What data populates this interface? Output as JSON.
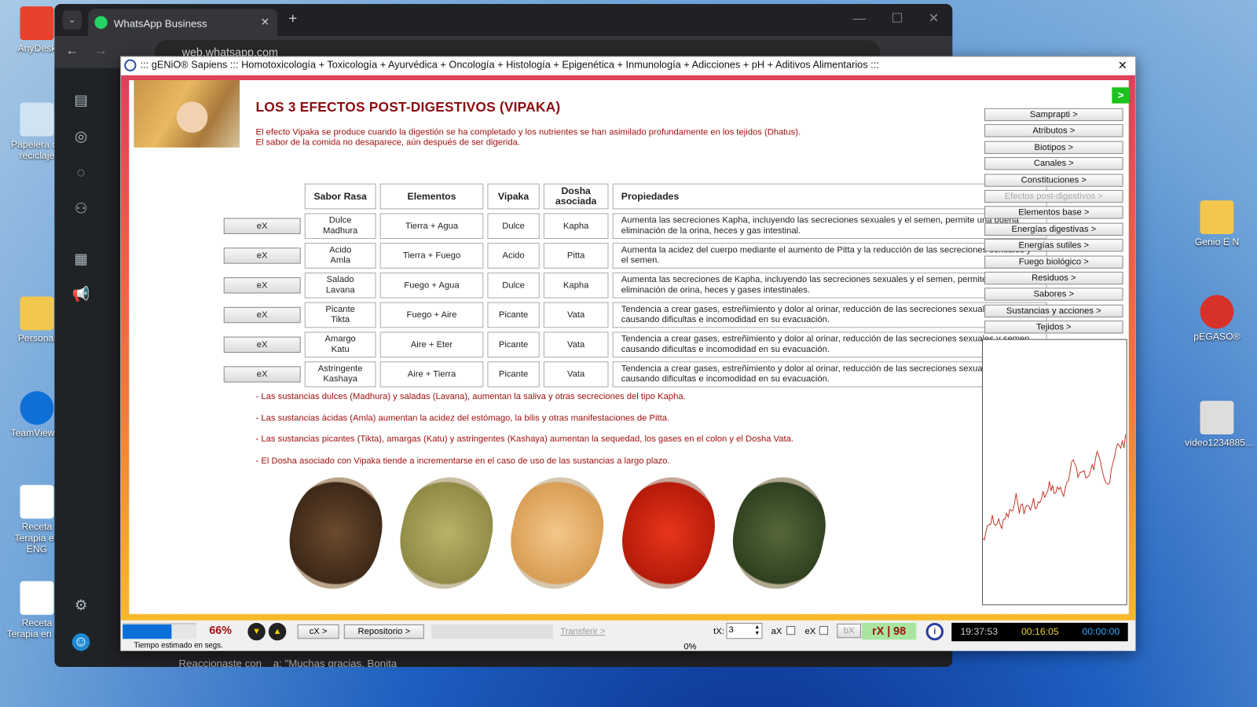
{
  "desktop": {
    "left_icons": [
      "AnyDesk",
      "Papelera de reciclaje",
      "Personal",
      "TeamViewer",
      "Receta Terapia en ENG",
      "Receta Terapia en ES"
    ],
    "right_icons": [
      "Genio E N",
      "pEGASO®",
      "video1234885..."
    ]
  },
  "browser": {
    "tab_title": "WhatsApp Business",
    "url": "web.whatsapp.com",
    "chat_preview": "Reaccionaste con",
    "chat_preview2": "a: \"Muchas gracias. Bonita"
  },
  "dialog": {
    "title": "::: gENiO® Sapiens ::: Homotoxicología + Toxicología + Ayurvédica + Oncología + Histología + Epigenética + Inmunología + Adicciones + pH + Aditivos Alimentarios :::",
    "heading": "LOS 3 EFECTOS POST-DIGESTIVOS (VIPAKA)",
    "intro": [
      "El efecto Vipaka se produce cuando la digestión se ha completado y los nutrientes se han asimilado profundamente en los tejidos (Dhatus).",
      "El sabor de la comida no desaparece, aún después de ser digerida."
    ],
    "table": {
      "headers": [
        "Sabor Rasa",
        "Elementos",
        "Vipaka",
        "Dosha asociada",
        "Propiedades"
      ],
      "button_label": "eX",
      "rows": [
        {
          "sabor": "Dulce",
          "rasa": "Madhura",
          "elementos": "Tierra + Agua",
          "vipaka": "Dulce",
          "dosha": "Kapha",
          "prop": "Aumenta las secreciones Kapha, incluyendo las secreciones sexuales y el semen, permite una buena eliminación de la orina, heces y gas intestinal."
        },
        {
          "sabor": "Acido",
          "rasa": "Amla",
          "elementos": "Tierra + Fuego",
          "vipaka": "Acido",
          "dosha": "Pitta",
          "prop": "Aumenta la acidez del cuerpo mediante el aumento de Pitta y la reducción de las secreciones sexuales y el semen."
        },
        {
          "sabor": "Salado",
          "rasa": "Lavana",
          "elementos": "Fuego + Agua",
          "vipaka": "Dulce",
          "dosha": "Kapha",
          "prop": "Aumenta las secreciones de Kapha, incluyendo las secreciones sexuales y el semen, permite una buena eliminación de orina, heces y gases intestinales."
        },
        {
          "sabor": "Picante",
          "rasa": "Tikta",
          "elementos": "Fuego + Aire",
          "vipaka": "Picante",
          "dosha": "Vata",
          "prop": "Tendencia a crear gases, estreñimiento y dolor al orinar, reducción de las secreciones sexuales y semen, causando dificultas e incomodidad en su evacuación."
        },
        {
          "sabor": "Amargo",
          "rasa": "Katu",
          "elementos": "Aire + Eter",
          "vipaka": "Picante",
          "dosha": "Vata",
          "prop": "Tendencia a crear gases, estreñimiento y dolor al orinar, reducción de las secreciones sexuales y semen, causando dificultas e incomodidad en su evacuación."
        },
        {
          "sabor": "Astringente",
          "rasa": "Kashaya",
          "elementos": "Aire + Tierra",
          "vipaka": "Picante",
          "dosha": "Vata",
          "prop": "Tendencia a crear gases, estreñimiento y dolor al orinar, reducción de las secreciones sexuales y semen, causando dificultas e incomodidad en su evacuación."
        }
      ]
    },
    "notes": [
      "- Las sustancias dulces (Madhura) y saladas (Lavana), aumentan la saliva y otras secreciones del tipo Kapha.",
      "- Las sustancias ácidas (Amla) aumentan la acidez del estómago, la bilis y otras manifestaciones de Pitta.",
      "- Las sustancias picantes (Tikta), amargas (Katu) y astringentes (Kashaya) aumentan la sequedad, los gases en el colon y el Dosha Vata.",
      "- El Dosha asociado con Vipaka tiende a incrementarse en el caso de uso de las sustancias a largo plazo."
    ],
    "next_button": ">",
    "menu": [
      {
        "label": "Samprapti >"
      },
      {
        "label": "Atributos >"
      },
      {
        "label": "Biotipos >"
      },
      {
        "label": "Canales >"
      },
      {
        "label": "Constituciones >"
      },
      {
        "label": "Efectos post-digestivos >",
        "disabled": true
      },
      {
        "label": "Elementos base >"
      },
      {
        "label": "Energías digestivas >"
      },
      {
        "label": "Energías sutiles >"
      },
      {
        "label": "Fuego biológico >"
      },
      {
        "label": "Residuos >"
      },
      {
        "label": "Sabores >"
      },
      {
        "label": "Sustancias y acciones >"
      },
      {
        "label": "Tejidos >"
      }
    ],
    "bottom": {
      "progress_label": "66%",
      "progress_value": 0.66,
      "cx": "cX >",
      "repositorio": "Repositorio >",
      "transferir": "Transferir >",
      "transfer_pct": "0%",
      "estimado": "Tiempo estimado en segs.",
      "tx_label": "tX:",
      "tx_value": "3",
      "ax": "aX",
      "ex": "eX",
      "bx": "bX",
      "rx": "rX | 98",
      "clock": "19:37:53",
      "elapsed": "00:16:05",
      "timer": "00:00:00"
    },
    "colors": {
      "heading": "#8b0d12",
      "text_red": "#a01010",
      "rx_bg": "#a8e6a0"
    }
  }
}
